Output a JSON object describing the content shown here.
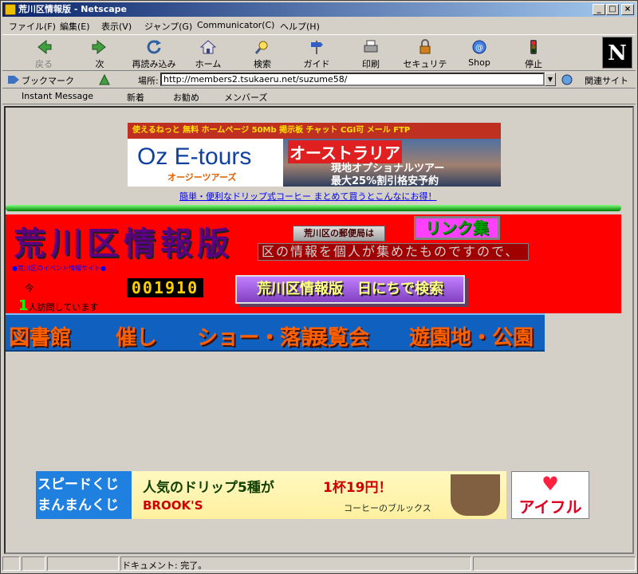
{
  "window": {
    "title": "荒川区情報版 - Netscape",
    "minimize": "_",
    "maximize": "□",
    "close": "×"
  },
  "menu": [
    "ファイル(F)",
    "編集(E)",
    "表示(V)",
    "ジャンプ(G)",
    "Communicator(C)",
    "ヘルプ(H)"
  ],
  "toolbar": {
    "back": "戻る",
    "forward": "次",
    "reload": "再読み込み",
    "home": "ホーム",
    "search": "検索",
    "guide": "ガイド",
    "print": "印刷",
    "security": "セキュリティ",
    "shop": "Shop",
    "stop": "停止",
    "logo": "N"
  },
  "location": {
    "bookmarks": "ブックマーク",
    "label": "場所:",
    "url": "http://members2.tsukaeru.net/suzume58/",
    "related": "関連サイト"
  },
  "personal": {
    "instant": "Instant Message",
    "new": "新着",
    "recommend": "お勧め",
    "members": "メンバーズ"
  },
  "page": {
    "banner_top": "使えるねっと 無料 ホームページ 50Mb 掲示板 チャット CGI可 メール FTP",
    "oz": "Oz E-tours",
    "oz_jp": "オージーツアーズ",
    "au_title": "オーストラリア",
    "au_line1": "現地オプショナルツアー",
    "au_line2": "最大25%割引格安予約",
    "ad_link": "簡単・便利なドリップ式コーヒー まとめて買うとこんなにお得！",
    "site_title": "荒川区情報版",
    "post_office": "荒川区の郵便局は",
    "links": "リンク集",
    "marquee": "区の情報を個人が集めたものですので、",
    "event_link": "●荒川区のイベント情報サイト●",
    "count_pre": "今",
    "count_num": "1",
    "count_post": "人訪問しています",
    "counter": "001910",
    "search_btn": "荒川区情報版　日にちで検索",
    "nav": [
      "図書館",
      "催し",
      "ショー・落語",
      "展覧会",
      "遊園地・公園"
    ]
  },
  "ads": {
    "speed": "スピードくじ まんまんくじ",
    "brooks_head": "人気のドリップ5種が",
    "brooks_price": "1杯19円！",
    "brooks_brand": "BROOK'S",
    "brooks_sub": "コーヒーのブルックス",
    "aiful": "アイフル"
  },
  "status": {
    "text": "ドキュメント: 完了。"
  }
}
